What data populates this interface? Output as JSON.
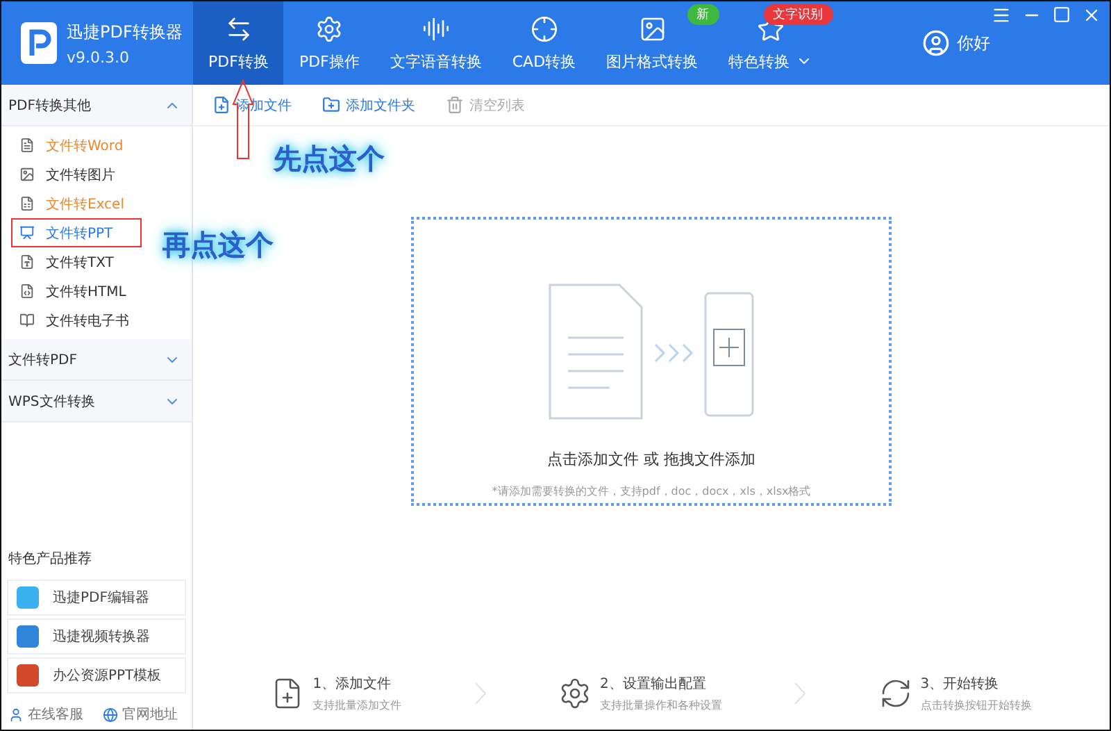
{
  "app": {
    "name": "迅捷PDF转换器",
    "version": "v9.0.3.0"
  },
  "nav_tabs": [
    {
      "label": "PDF转换",
      "selected": true
    },
    {
      "label": "PDF操作",
      "selected": false
    },
    {
      "label": "文字语音转换",
      "selected": false
    },
    {
      "label": "CAD转换",
      "selected": false
    },
    {
      "label": "图片格式转换",
      "selected": false,
      "badge": {
        "text": "新",
        "color": "#3fb83f"
      }
    },
    {
      "label": "特色转换",
      "selected": false,
      "dropdown": true,
      "badge": {
        "text": "文字识别",
        "color": "#e8383d"
      }
    }
  ],
  "user": {
    "label": "你好"
  },
  "sidebar": {
    "groups": [
      {
        "title": "PDF转换其他",
        "expanded": true,
        "items": [
          {
            "label": "文件转Word",
            "color": "#e8892c",
            "selected": false
          },
          {
            "label": "文件转图片",
            "color": "#333333",
            "selected": false
          },
          {
            "label": "文件转Excel",
            "color": "#e8892c",
            "selected": false
          },
          {
            "label": "文件转PPT",
            "color": "#2b7ae8",
            "selected": true
          },
          {
            "label": "文件转TXT",
            "color": "#333333",
            "selected": false
          },
          {
            "label": "文件转HTML",
            "color": "#333333",
            "selected": false
          },
          {
            "label": "文件转电子书",
            "color": "#333333",
            "selected": false
          }
        ]
      },
      {
        "title": "文件转PDF",
        "expanded": false
      },
      {
        "title": "WPS文件转换",
        "expanded": false
      }
    ],
    "promo_title": "特色产品推荐",
    "promos": [
      {
        "label": "迅捷PDF编辑器"
      },
      {
        "label": "迅捷视频转换器"
      },
      {
        "label": "办公资源PPT模板"
      }
    ],
    "footer_links": [
      {
        "label": "在线客服"
      },
      {
        "label": "官网地址"
      }
    ]
  },
  "toolbar": [
    {
      "label": "添加文件",
      "disabled": false
    },
    {
      "label": "添加文件夹",
      "disabled": false
    },
    {
      "label": "清空列表",
      "disabled": true
    }
  ],
  "drop_zone": {
    "title": "点击添加文件 或 拖拽文件添加",
    "hint": "*请添加需要转换的文件，支持pdf，doc，docx，xls，xlsx格式"
  },
  "steps": [
    {
      "title": "1、添加文件",
      "subtitle": "支持批量添加文件"
    },
    {
      "title": "2、设置输出配置",
      "subtitle": "支持批量操作和各种设置"
    },
    {
      "title": "3、开始转换",
      "subtitle": "点击转换按钮开始转换"
    }
  ],
  "annotations": [
    {
      "text": "先点这个"
    },
    {
      "text": "再点这个"
    }
  ]
}
